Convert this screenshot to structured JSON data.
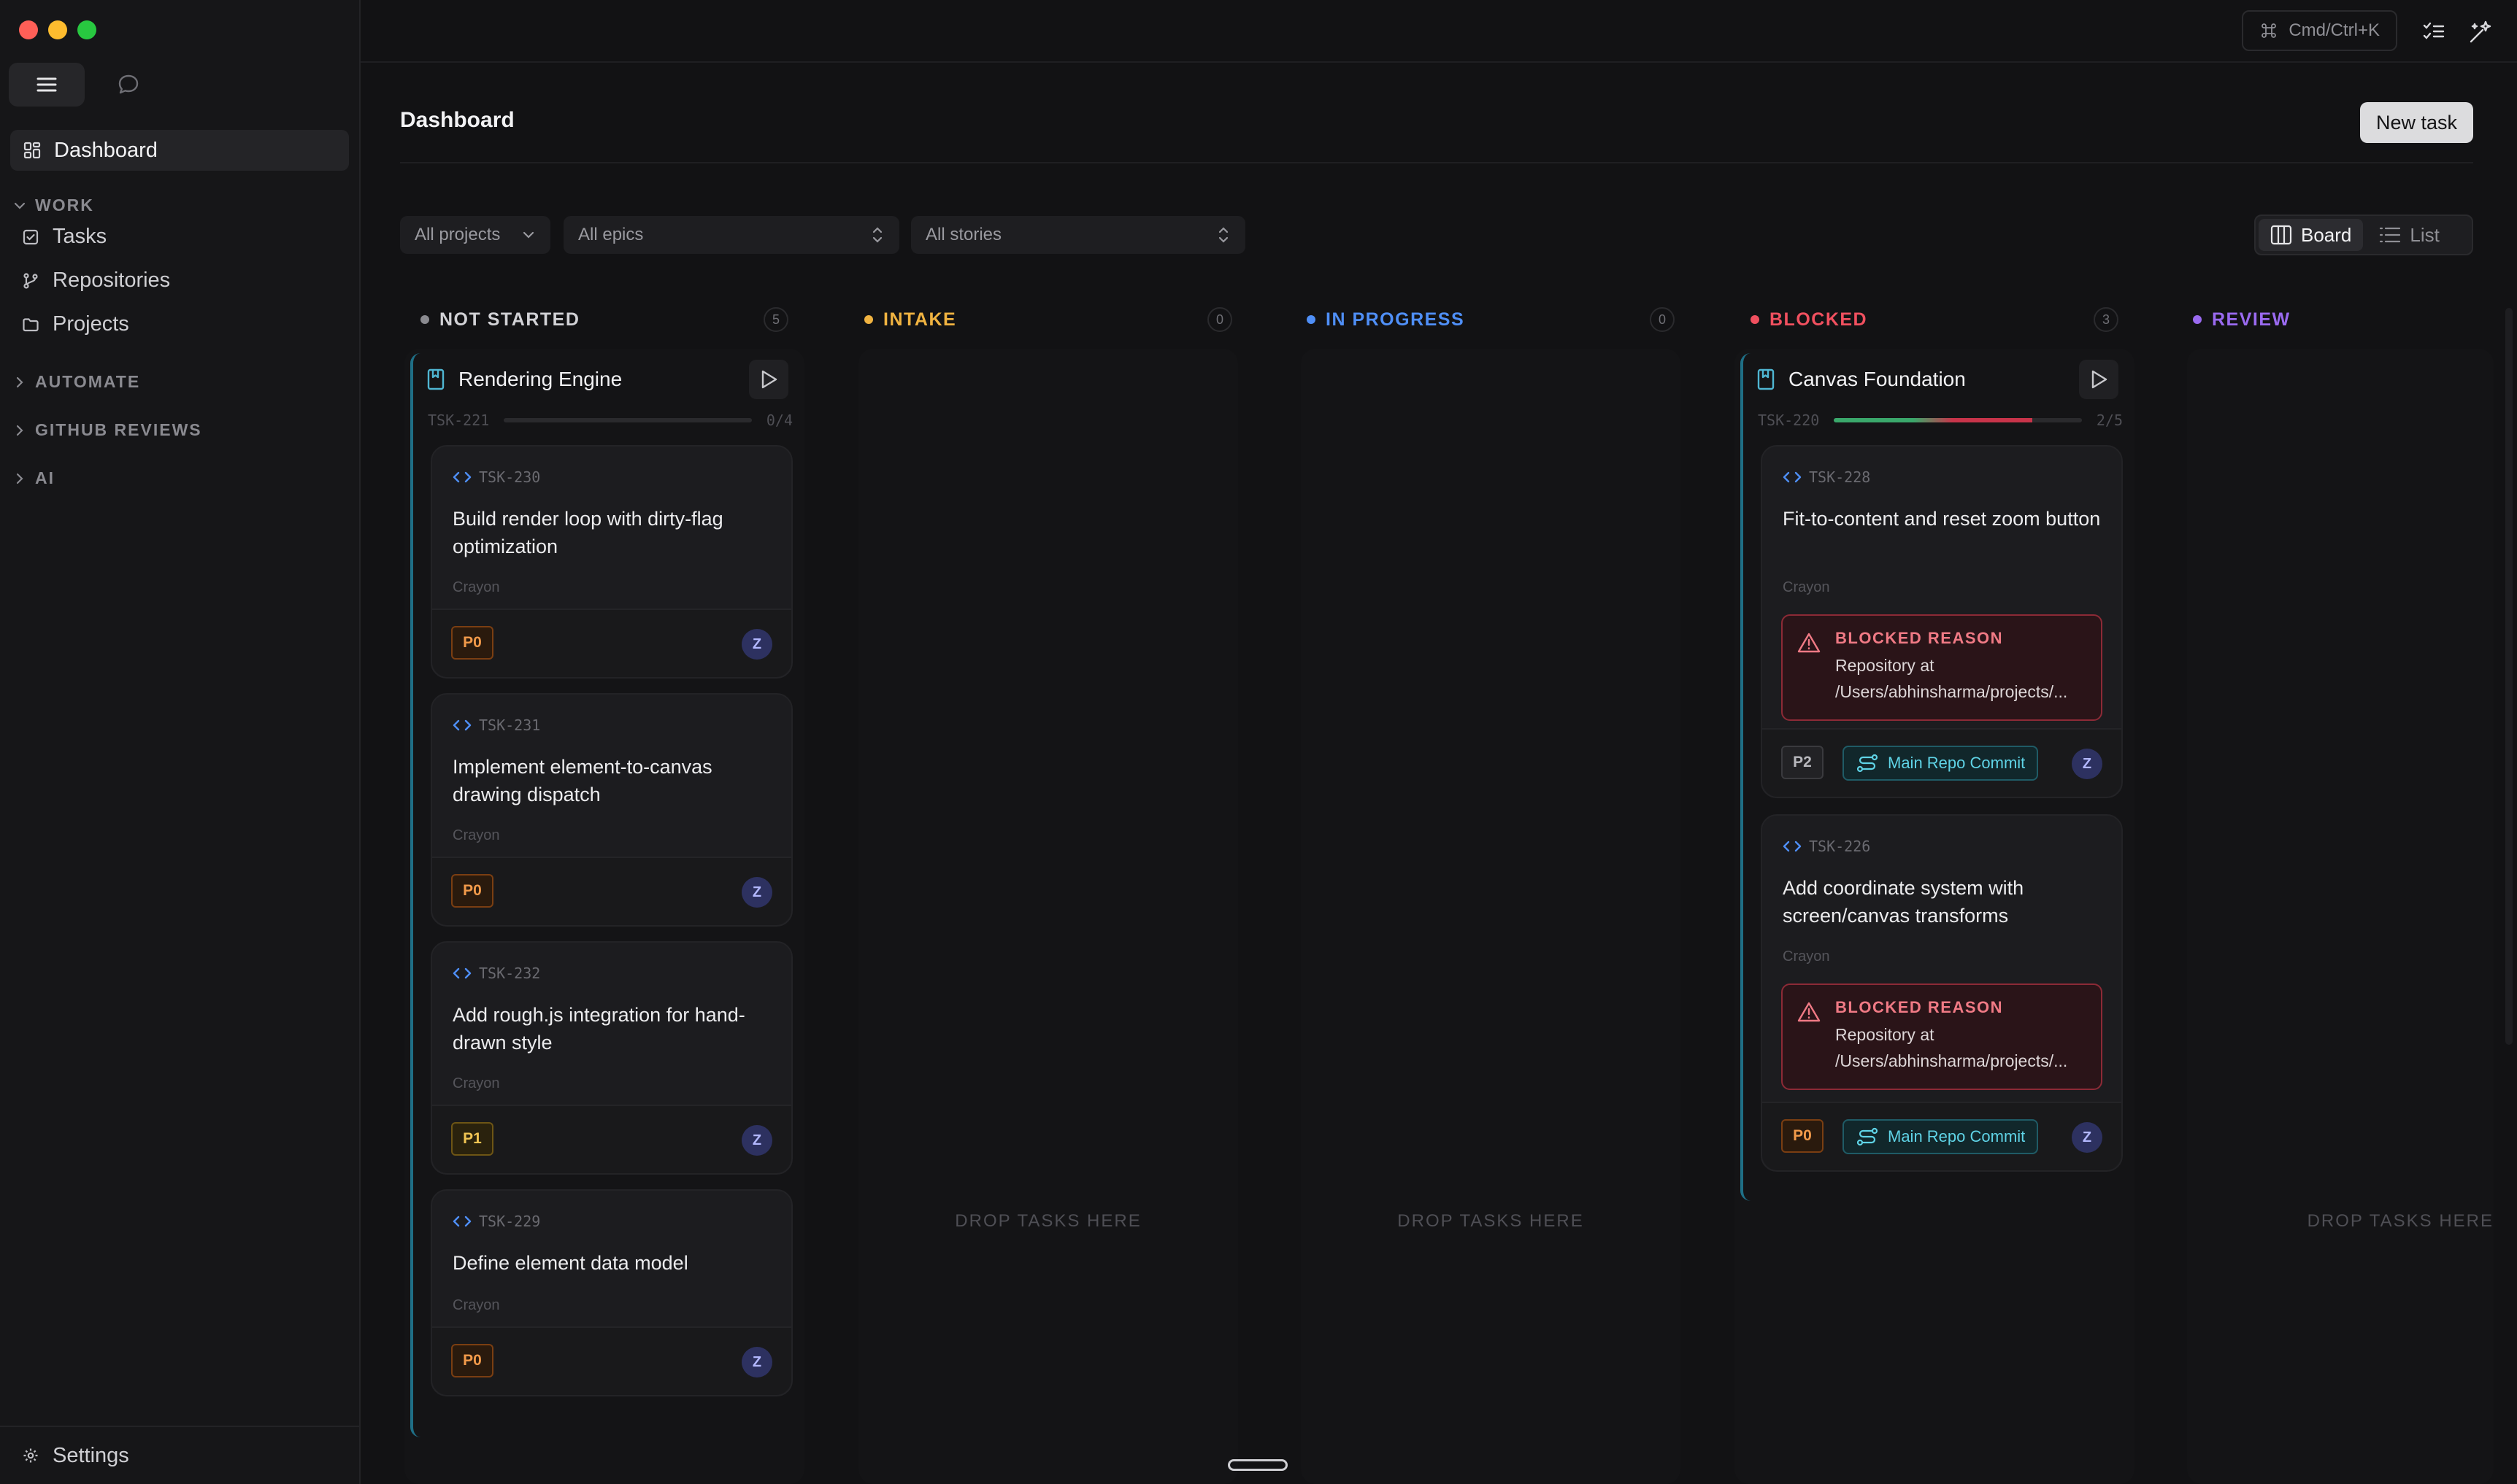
{
  "sidebar": {
    "nav_dashboard": "Dashboard",
    "section_work": "WORK",
    "items": [
      {
        "label": "Tasks"
      },
      {
        "label": "Repositories"
      },
      {
        "label": "Projects"
      }
    ],
    "section_automate": "AUTOMATE",
    "section_github": "GITHUB REVIEWS",
    "section_ai": "AI",
    "settings": "Settings"
  },
  "topbar": {
    "shortcut": "Cmd/Ctrl+K"
  },
  "page": {
    "title": "Dashboard",
    "new_task": "New task"
  },
  "filters": {
    "projects": "All projects",
    "epics": "All epics",
    "stories": "All stories"
  },
  "view_toggle": {
    "board": "Board",
    "list": "List",
    "active": "Board"
  },
  "columns": [
    {
      "name": "NOT STARTED",
      "count": "5",
      "color": "#8a8a90"
    },
    {
      "name": "INTAKE",
      "count": "0",
      "color": "#f0b341"
    },
    {
      "name": "IN PROGRESS",
      "count": "0",
      "color": "#4f8ff7"
    },
    {
      "name": "BLOCKED",
      "count": "3",
      "color": "#f0505f"
    },
    {
      "name": "REVIEW",
      "color": "#9a6af0"
    }
  ],
  "drop_text": "DROP TASKS HERE",
  "not_started": {
    "epic": {
      "title": "Rendering Engine",
      "id": "TSK-221",
      "progress": "0/4",
      "progress_fraction": 0
    },
    "cards": [
      {
        "id": "TSK-230",
        "title": "Build render loop with dirty-flag optimization",
        "project": "Crayon",
        "priority": "P0",
        "assignee": "Z"
      },
      {
        "id": "TSK-231",
        "title": "Implement element-to-canvas drawing dispatch",
        "project": "Crayon",
        "priority": "P0",
        "assignee": "Z"
      },
      {
        "id": "TSK-232",
        "title": "Add rough.js integration for hand-drawn style",
        "project": "Crayon",
        "priority": "P1",
        "assignee": "Z"
      },
      {
        "id": "TSK-229",
        "title": "Define element data model",
        "project": "Crayon",
        "priority": "P0",
        "assignee": "Z"
      }
    ]
  },
  "blocked": {
    "epic": {
      "title": "Canvas Foundation",
      "id": "TSK-220",
      "progress": "2/5",
      "progress_fraction": 0.8
    },
    "cards": [
      {
        "id": "TSK-228",
        "title": "Fit-to-content and reset zoom button",
        "project": "Crayon",
        "blocked_label": "BLOCKED REASON",
        "blocked_line1": "Repository at",
        "blocked_line2": "/Users/abhinsharma/projects/...",
        "priority": "P2",
        "repo": "Main Repo Commit",
        "assignee": "Z"
      },
      {
        "id": "TSK-226",
        "title": "Add coordinate system with screen/canvas transforms",
        "project": "Crayon",
        "blocked_label": "BLOCKED REASON",
        "blocked_line1": "Repository at",
        "blocked_line2": "/Users/abhinsharma/projects/...",
        "priority": "P0",
        "repo": "Main Repo Commit",
        "assignee": "Z"
      }
    ]
  }
}
